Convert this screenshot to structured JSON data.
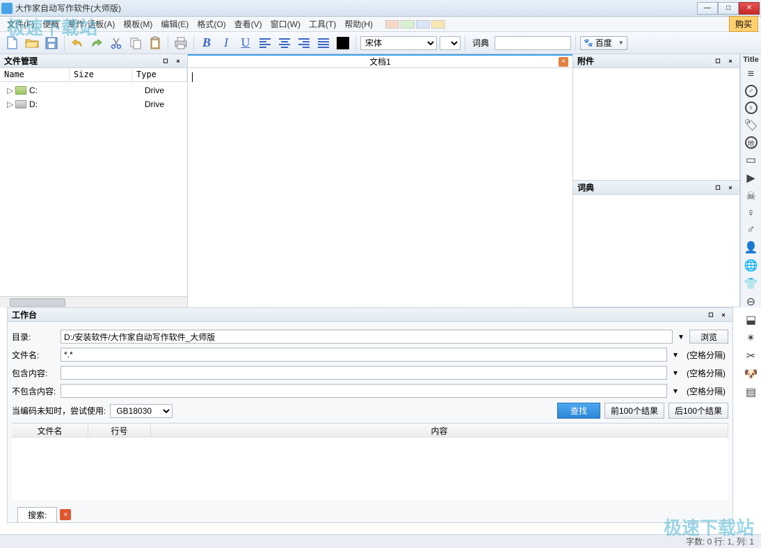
{
  "window": {
    "title": "大作家自动写作软件(大师版)"
  },
  "menu": {
    "file": "文件(F)",
    "overview": "便概",
    "articles": "草作·话板(A)",
    "template": "模板(M)",
    "edit": "编辑(E)",
    "format": "格式(O)",
    "view": "查看(V)",
    "window": "窗口(W)",
    "tools": "工具(T)",
    "help": "帮助(H)",
    "buy": "购买"
  },
  "toolbar": {
    "font": "宋体",
    "dict_label": "词典",
    "search_engine": "百度"
  },
  "file_manager": {
    "title": "文件管理",
    "cols": {
      "name": "Name",
      "size": "Size",
      "type": "Type"
    },
    "rows": [
      {
        "label": "C:",
        "type": "Drive"
      },
      {
        "label": "D:",
        "type": "Drive"
      }
    ]
  },
  "document": {
    "tab_title": "文档1"
  },
  "attachment": {
    "title": "附件"
  },
  "dictionary": {
    "title": "词典"
  },
  "sidebar_title": "Title",
  "worktable": {
    "title": "工作台",
    "dir_label": "目录:",
    "dir_value": "D:/安装软件/大作家自动写作软件_大师版",
    "browse": "浏览",
    "filename_label": "文件名:",
    "filename_value": "*.*",
    "include_label": "包含内容:",
    "exclude_label": "不包含内容:",
    "hint": "(空格分隔)",
    "encoding_label": "当编码未知时，尝试使用:",
    "encoding_value": "GB18030",
    "search": "查找",
    "prev": "前100个结果",
    "next": "后100个结果",
    "result_cols": {
      "file": "文件名",
      "line": "行号",
      "content": "内容"
    },
    "search_tab": "搜索:"
  },
  "statusbar": {
    "text": "字数: 0 行: 1, 列: 1"
  },
  "watermark": "极速下载站"
}
